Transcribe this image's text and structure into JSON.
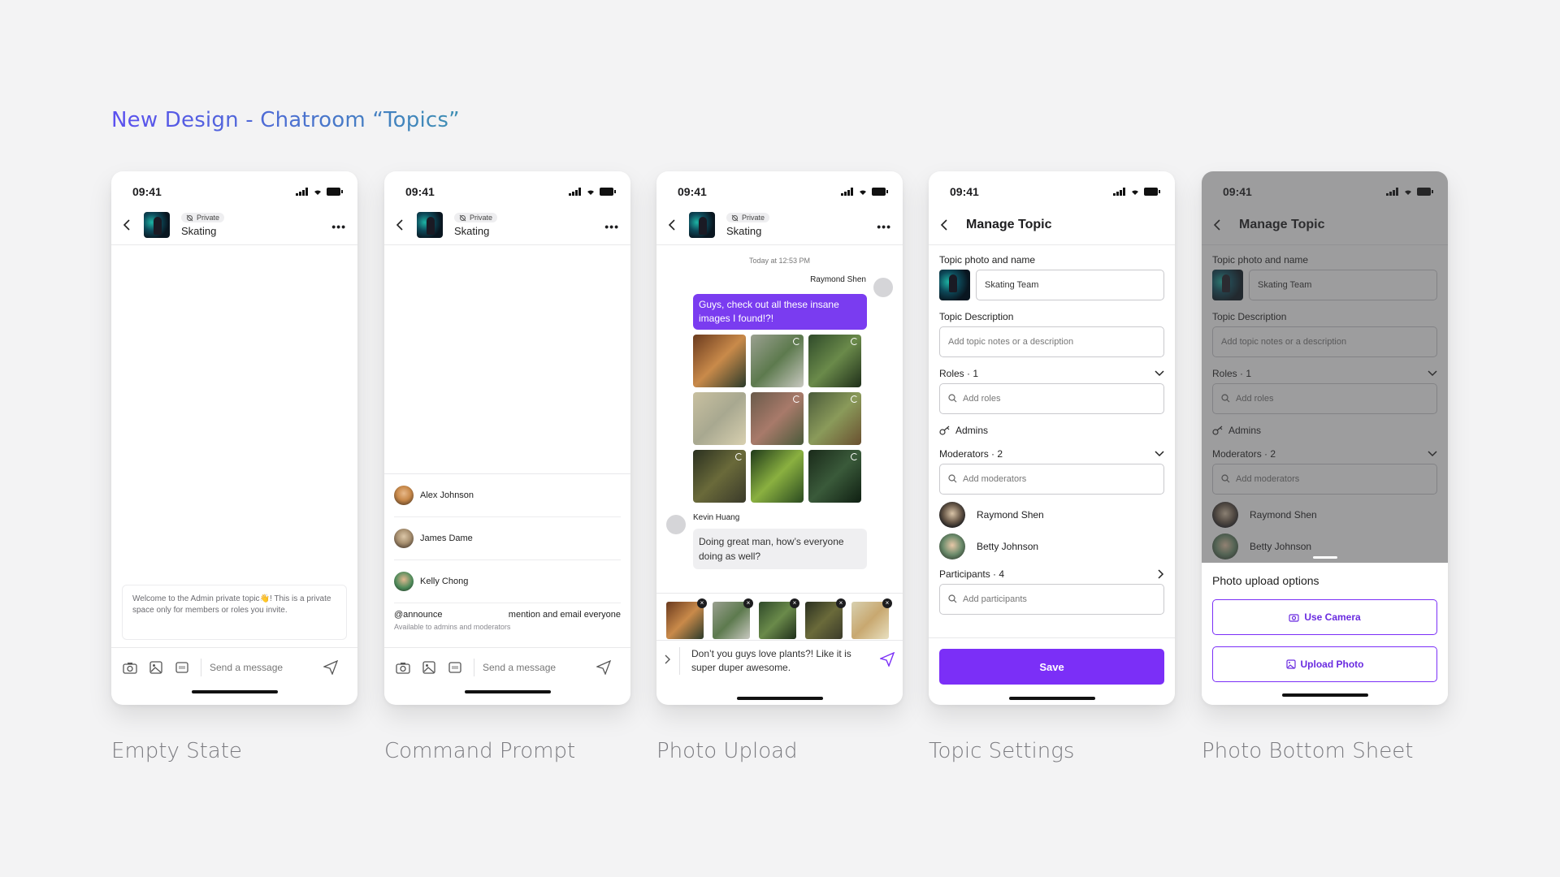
{
  "page": {
    "title": "New Design - Chatroom “Topics”"
  },
  "captions": [
    "Empty State",
    "Command Prompt",
    "Photo Upload",
    "Topic Settings",
    "Photo Bottom Sheet"
  ],
  "status": {
    "time": "09:41"
  },
  "chat": {
    "badge": "Private",
    "topic_name": "Skating",
    "composer_placeholder": "Send a message",
    "more": "•••"
  },
  "empty_state": {
    "welcome": "Welcome to the Admin private topic👋! This is a private space only for members or roles you invite."
  },
  "command_prompt": {
    "mentions": [
      {
        "name": "Alex Johnson",
        "color": "#c8894a"
      },
      {
        "name": "James Dame",
        "color": "#a89070"
      },
      {
        "name": "Kelly Chong",
        "color": "#4f8a5a"
      }
    ],
    "command": "@announce",
    "command_desc": "mention and email everyone",
    "command_sub": "Available to admins and moderators"
  },
  "photo_upload": {
    "timestamp": "Today at 12:53 PM",
    "sender_right": "Raymond Shen",
    "message_right": "Guys, check out all these insane images I found!?!",
    "sender_left": "Kevin Huang",
    "message_left": "Doing great man, how’s everyone doing as well?",
    "input_text": "Don’t you guys love plants?! Like it is super duper awesome.",
    "close_glyph": "×"
  },
  "manage_topic": {
    "title": "Manage Topic",
    "photo_label": "Topic photo and name",
    "name_value": "Skating Team",
    "desc_label": "Topic Description",
    "desc_placeholder": "Add topic notes or a description",
    "roles_label": "Roles · 1",
    "roles_placeholder": "Add roles",
    "role_admins": "Admins",
    "mods_label": "Moderators · 2",
    "mods_placeholder": "Add moderators",
    "moderators": [
      "Raymond Shen",
      "Betty Johnson"
    ],
    "participants_label": "Participants · 4",
    "participants_placeholder": "Add participants",
    "save": "Save"
  },
  "bottom_sheet": {
    "title": "Photo upload options",
    "use_camera": "Use Camera",
    "upload_photo": "Upload Photo"
  },
  "colors": {
    "accent": "#7b2ff7",
    "bubble": "#7a3cf0",
    "title_gradient_start": "#5b4ff0",
    "title_gradient_end": "#3d8fb3"
  }
}
